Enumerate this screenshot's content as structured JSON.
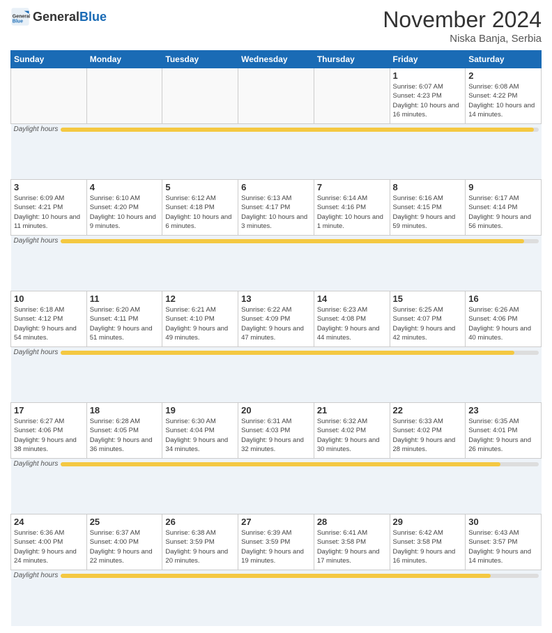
{
  "header": {
    "logo_general": "General",
    "logo_blue": "Blue",
    "month_title": "November 2024",
    "subtitle": "Niska Banja, Serbia"
  },
  "days_of_week": [
    "Sunday",
    "Monday",
    "Tuesday",
    "Wednesday",
    "Thursday",
    "Friday",
    "Saturday"
  ],
  "weeks": [
    [
      {
        "day": "",
        "info": ""
      },
      {
        "day": "",
        "info": ""
      },
      {
        "day": "",
        "info": ""
      },
      {
        "day": "",
        "info": ""
      },
      {
        "day": "",
        "info": ""
      },
      {
        "day": "1",
        "info": "Sunrise: 6:07 AM\nSunset: 4:23 PM\nDaylight: 10 hours and 16 minutes."
      },
      {
        "day": "2",
        "info": "Sunrise: 6:08 AM\nSunset: 4:22 PM\nDaylight: 10 hours and 14 minutes."
      }
    ],
    [
      {
        "day": "3",
        "info": "Sunrise: 6:09 AM\nSunset: 4:21 PM\nDaylight: 10 hours and 11 minutes."
      },
      {
        "day": "4",
        "info": "Sunrise: 6:10 AM\nSunset: 4:20 PM\nDaylight: 10 hours and 9 minutes."
      },
      {
        "day": "5",
        "info": "Sunrise: 6:12 AM\nSunset: 4:18 PM\nDaylight: 10 hours and 6 minutes."
      },
      {
        "day": "6",
        "info": "Sunrise: 6:13 AM\nSunset: 4:17 PM\nDaylight: 10 hours and 3 minutes."
      },
      {
        "day": "7",
        "info": "Sunrise: 6:14 AM\nSunset: 4:16 PM\nDaylight: 10 hours and 1 minute."
      },
      {
        "day": "8",
        "info": "Sunrise: 6:16 AM\nSunset: 4:15 PM\nDaylight: 9 hours and 59 minutes."
      },
      {
        "day": "9",
        "info": "Sunrise: 6:17 AM\nSunset: 4:14 PM\nDaylight: 9 hours and 56 minutes."
      }
    ],
    [
      {
        "day": "10",
        "info": "Sunrise: 6:18 AM\nSunset: 4:12 PM\nDaylight: 9 hours and 54 minutes."
      },
      {
        "day": "11",
        "info": "Sunrise: 6:20 AM\nSunset: 4:11 PM\nDaylight: 9 hours and 51 minutes."
      },
      {
        "day": "12",
        "info": "Sunrise: 6:21 AM\nSunset: 4:10 PM\nDaylight: 9 hours and 49 minutes."
      },
      {
        "day": "13",
        "info": "Sunrise: 6:22 AM\nSunset: 4:09 PM\nDaylight: 9 hours and 47 minutes."
      },
      {
        "day": "14",
        "info": "Sunrise: 6:23 AM\nSunset: 4:08 PM\nDaylight: 9 hours and 44 minutes."
      },
      {
        "day": "15",
        "info": "Sunrise: 6:25 AM\nSunset: 4:07 PM\nDaylight: 9 hours and 42 minutes."
      },
      {
        "day": "16",
        "info": "Sunrise: 6:26 AM\nSunset: 4:06 PM\nDaylight: 9 hours and 40 minutes."
      }
    ],
    [
      {
        "day": "17",
        "info": "Sunrise: 6:27 AM\nSunset: 4:06 PM\nDaylight: 9 hours and 38 minutes."
      },
      {
        "day": "18",
        "info": "Sunrise: 6:28 AM\nSunset: 4:05 PM\nDaylight: 9 hours and 36 minutes."
      },
      {
        "day": "19",
        "info": "Sunrise: 6:30 AM\nSunset: 4:04 PM\nDaylight: 9 hours and 34 minutes."
      },
      {
        "day": "20",
        "info": "Sunrise: 6:31 AM\nSunset: 4:03 PM\nDaylight: 9 hours and 32 minutes."
      },
      {
        "day": "21",
        "info": "Sunrise: 6:32 AM\nSunset: 4:02 PM\nDaylight: 9 hours and 30 minutes."
      },
      {
        "day": "22",
        "info": "Sunrise: 6:33 AM\nSunset: 4:02 PM\nDaylight: 9 hours and 28 minutes."
      },
      {
        "day": "23",
        "info": "Sunrise: 6:35 AM\nSunset: 4:01 PM\nDaylight: 9 hours and 26 minutes."
      }
    ],
    [
      {
        "day": "24",
        "info": "Sunrise: 6:36 AM\nSunset: 4:00 PM\nDaylight: 9 hours and 24 minutes."
      },
      {
        "day": "25",
        "info": "Sunrise: 6:37 AM\nSunset: 4:00 PM\nDaylight: 9 hours and 22 minutes."
      },
      {
        "day": "26",
        "info": "Sunrise: 6:38 AM\nSunset: 3:59 PM\nDaylight: 9 hours and 20 minutes."
      },
      {
        "day": "27",
        "info": "Sunrise: 6:39 AM\nSunset: 3:59 PM\nDaylight: 9 hours and 19 minutes."
      },
      {
        "day": "28",
        "info": "Sunrise: 6:41 AM\nSunset: 3:58 PM\nDaylight: 9 hours and 17 minutes."
      },
      {
        "day": "29",
        "info": "Sunrise: 6:42 AM\nSunset: 3:58 PM\nDaylight: 9 hours and 16 minutes."
      },
      {
        "day": "30",
        "info": "Sunrise: 6:43 AM\nSunset: 3:57 PM\nDaylight: 9 hours and 14 minutes."
      }
    ]
  ],
  "daylight_label": "Daylight hours"
}
